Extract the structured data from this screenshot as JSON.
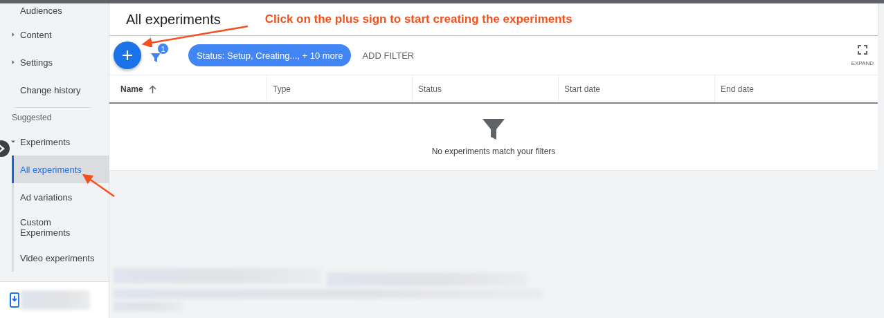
{
  "sidebar": {
    "items": [
      {
        "label": "Audiences",
        "kind": "link"
      },
      {
        "label": "Content",
        "kind": "group",
        "expanded": false
      },
      {
        "label": "Settings",
        "kind": "group",
        "expanded": false
      },
      {
        "label": "Change history",
        "kind": "link"
      },
      {
        "label": "Suggested",
        "kind": "section"
      },
      {
        "label": "Experiments",
        "kind": "group",
        "expanded": true,
        "children": [
          {
            "label": "All experiments",
            "selected": true
          },
          {
            "label": "Ad variations",
            "selected": false
          },
          {
            "label": "Custom Experiments",
            "selected": false
          },
          {
            "label": "Video experiments",
            "selected": false
          }
        ]
      }
    ]
  },
  "page": {
    "title": "All experiments"
  },
  "annotations": [
    {
      "text": "Click on the plus sign to start creating the experiments"
    }
  ],
  "toolbar": {
    "filter_count": "1",
    "filter_chip": "Status: Setup, Creating..., + 10 more",
    "add_filter": "ADD FILTER",
    "expand": "EXPAND"
  },
  "table": {
    "columns": [
      {
        "label": "Name",
        "sorted": true
      },
      {
        "label": "Type",
        "sorted": false
      },
      {
        "label": "Status",
        "sorted": false
      },
      {
        "label": "Start date",
        "sorted": false
      },
      {
        "label": "End date",
        "sorted": false
      }
    ],
    "empty_message": "No experiments match your filters"
  }
}
